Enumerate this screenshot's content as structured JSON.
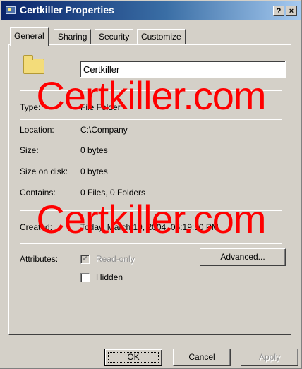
{
  "window": {
    "title": "Certkiller Properties",
    "help_label": "?",
    "close_label": "×"
  },
  "tabs": [
    {
      "label": "General",
      "active": true
    },
    {
      "label": "Sharing",
      "active": false
    },
    {
      "label": "Security",
      "active": false
    },
    {
      "label": "Customize",
      "active": false
    }
  ],
  "general": {
    "folder_name": "Certkiller",
    "type": {
      "label": "Type:",
      "value": "File Folder"
    },
    "location": {
      "label": "Location:",
      "value": "C:\\Company"
    },
    "size": {
      "label": "Size:",
      "value": "0 bytes"
    },
    "size_on_disk": {
      "label": "Size on disk:",
      "value": "0 bytes"
    },
    "contains": {
      "label": "Contains:",
      "value": "0 Files, 0 Folders"
    },
    "created": {
      "label": "Created:",
      "value": "Today, March 19, 2004, 06:19:10 PM"
    },
    "attributes": {
      "label": "Attributes:",
      "read_only": {
        "label": "Read-only",
        "checked": true,
        "disabled": true
      },
      "hidden": {
        "label": "Hidden",
        "checked": false,
        "disabled": false
      },
      "advanced_label": "Advanced..."
    }
  },
  "buttons": {
    "ok": "OK",
    "cancel": "Cancel",
    "apply": "Apply"
  },
  "watermark": "Certkiller.com",
  "colors": {
    "title_start": "#0a246a",
    "title_end": "#a6caf0",
    "dialog_face": "#d4d0c8",
    "watermark": "#ff0000"
  }
}
